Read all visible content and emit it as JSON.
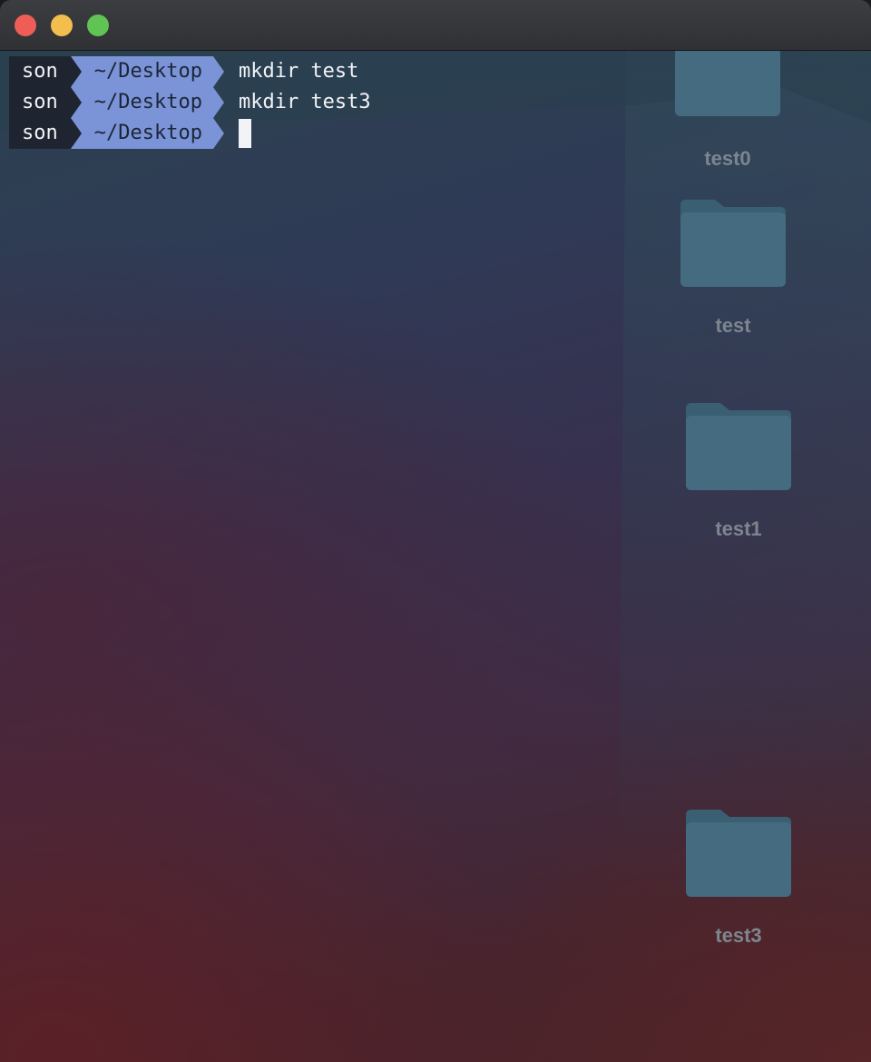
{
  "window": {
    "traffic_lights": {
      "close_color": "#ee5e57",
      "minimize_color": "#f4be4f",
      "zoom_color": "#5fc454"
    }
  },
  "terminal": {
    "lines": [
      {
        "user": "son",
        "dir": "~/Desktop",
        "command": "mkdir test"
      },
      {
        "user": "son",
        "dir": "~/Desktop",
        "command": "mkdir test3"
      },
      {
        "user": "son",
        "dir": "~/Desktop",
        "command": ""
      }
    ],
    "colors": {
      "user_segment": "#1f2530",
      "dir_segment": "#7b94d8"
    }
  },
  "desktop": {
    "folders": [
      {
        "name": "test0",
        "icon": "folder-icon"
      },
      {
        "name": "test",
        "icon": "folder-icon"
      },
      {
        "name": "test1",
        "icon": "folder-icon"
      },
      {
        "name": "test3",
        "icon": "folder-icon"
      }
    ],
    "folder_color": "#3f6478"
  }
}
